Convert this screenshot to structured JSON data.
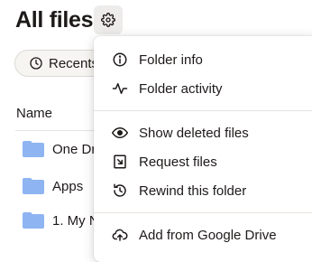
{
  "header": {
    "title": "All files"
  },
  "filters": {
    "recents_label": "Recents"
  },
  "list": {
    "column_name": "Name",
    "folders": [
      {
        "name": "One Dr",
        "icon": "folder-icon"
      },
      {
        "name": "Apps",
        "icon": "folder-icon"
      },
      {
        "name": "1. My N",
        "icon": "folder-icon"
      }
    ]
  },
  "menu": {
    "items": [
      {
        "label": "Folder info",
        "icon": "info-icon"
      },
      {
        "label": "Folder activity",
        "icon": "activity-icon"
      },
      {
        "label": "Show deleted files",
        "icon": "eye-icon"
      },
      {
        "label": "Request files",
        "icon": "request-files-icon"
      },
      {
        "label": "Rewind this folder",
        "icon": "rewind-icon"
      },
      {
        "label": "Add from Google Drive",
        "icon": "cloud-upload-icon"
      }
    ]
  },
  "colors": {
    "folder": "#8fb4f2",
    "text": "#1e1919",
    "gear_bg": "#eeecea"
  }
}
